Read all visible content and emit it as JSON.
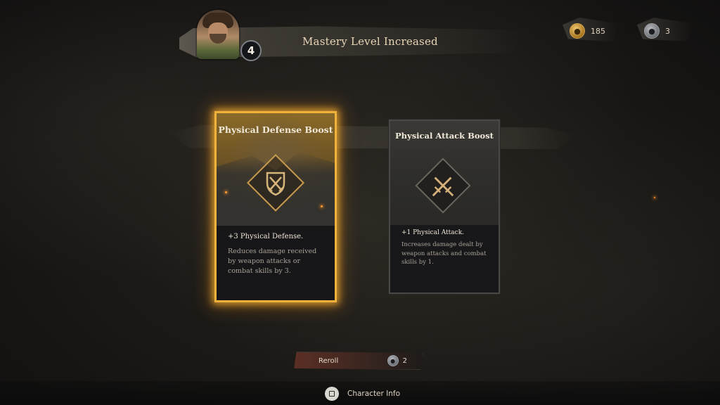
{
  "header": {
    "level": "4",
    "title": "Mastery Level Increased"
  },
  "currency": {
    "gold": {
      "icon": "gold-coin-icon",
      "value": "185"
    },
    "reroll_token": {
      "icon": "token-icon",
      "value": "3"
    }
  },
  "cards": [
    {
      "title": "Physical Defense Boost",
      "icon": "shield-swords-icon",
      "stat": "+3 Physical Defense.",
      "description": "Reduces damage received by weapon attacks or combat skills by 3.",
      "selected": true
    },
    {
      "title": "Physical Attack Boost",
      "icon": "crossed-swords-icon",
      "stat": "+1 Physical Attack.",
      "description": "Increases damage dealt by weapon attacks and combat skills by 1.",
      "selected": false
    }
  ],
  "reroll": {
    "label": "Reroll",
    "cost": "2",
    "cost_icon": "token-icon"
  },
  "footer": {
    "button_glyph": "square",
    "character_info_label": "Character Info"
  },
  "colors": {
    "selected_glow": "#f0b23a",
    "reroll_red": "#5b2f25",
    "gold": "#d7a44a"
  }
}
